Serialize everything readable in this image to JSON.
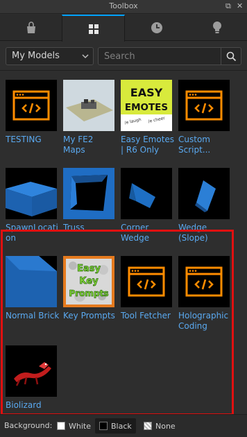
{
  "window": {
    "title": "Toolbox"
  },
  "tabs": [
    {
      "icon": "bag-icon",
      "active": false
    },
    {
      "icon": "grid-icon",
      "active": true
    },
    {
      "icon": "clock-icon",
      "active": false
    },
    {
      "icon": "lightbulb-icon",
      "active": false
    }
  ],
  "filter": {
    "category": "My Models",
    "search_placeholder": "Search",
    "search_value": ""
  },
  "items": [
    {
      "label": "TESTING",
      "thumb": "script-icon"
    },
    {
      "label": "My FE2 Maps",
      "thumb": "map-preview"
    },
    {
      "label": "Easy Emotes | R6 Only",
      "thumb": "easy-emotes-logo"
    },
    {
      "label": "Custom Script...",
      "thumb": "script-icon"
    },
    {
      "label": "SpawnLocation",
      "thumb": "spawnlocation-part"
    },
    {
      "label": "Truss",
      "thumb": "truss-part"
    },
    {
      "label": "Corner Wedge",
      "thumb": "corner-wedge-part"
    },
    {
      "label": "Wedge (Slope)",
      "thumb": "wedge-part"
    },
    {
      "label": "Normal Brick",
      "thumb": "brick-part"
    },
    {
      "label": "Key Prompts",
      "thumb": "key-prompts-logo"
    },
    {
      "label": "Tool Fetcher",
      "thumb": "script-icon"
    },
    {
      "label": "Holographic Coding",
      "thumb": "script-icon"
    },
    {
      "label": "Biolizard",
      "thumb": "biolizard-model"
    }
  ],
  "thumb_text": {
    "easy_emotes": [
      "EASY",
      "EMOTES",
      "/e laugh",
      "/e cheer"
    ],
    "key_prompts": [
      "Easy",
      "Key",
      "Prompts"
    ]
  },
  "colors": {
    "accent": "#00a2ff",
    "script_orange": "#ff8c00",
    "part_blue": "#1e6fc4",
    "link_blue": "#5aa9f0",
    "highlight_red": "#e01010"
  },
  "background": {
    "label": "Background:",
    "options": [
      {
        "label": "White",
        "selected": false
      },
      {
        "label": "Black",
        "selected": true
      },
      {
        "label": "None",
        "selected": false
      }
    ]
  }
}
